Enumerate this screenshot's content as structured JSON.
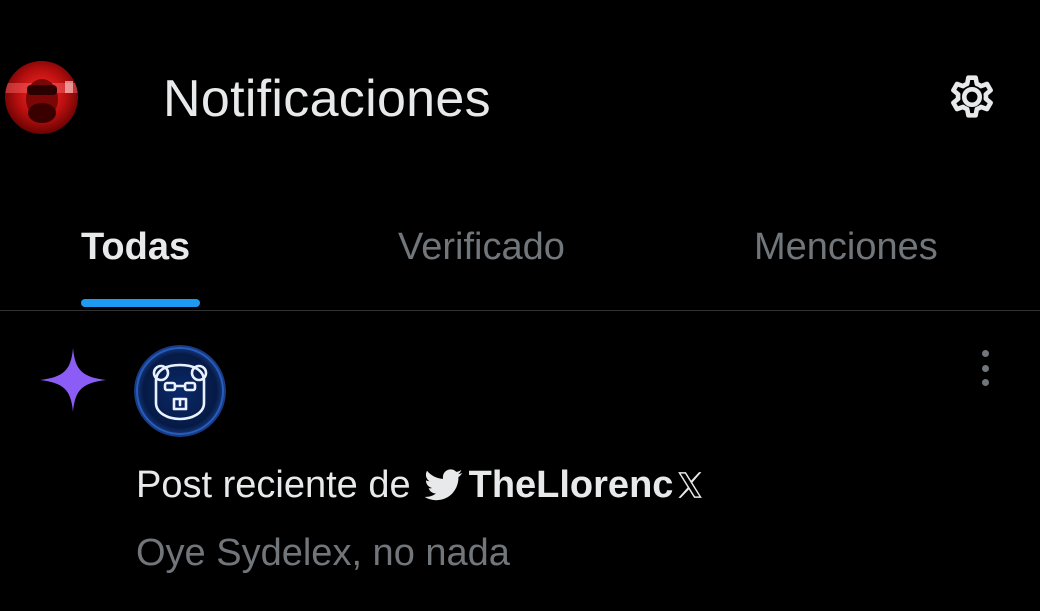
{
  "header": {
    "title": "Notificaciones",
    "avatar_icon": "user-avatar",
    "settings_icon": "gear-icon"
  },
  "tabs": [
    {
      "label": "Todas",
      "active": true
    },
    {
      "label": "Verificado",
      "active": false
    },
    {
      "label": "Menciones",
      "active": false
    }
  ],
  "notifications": [
    {
      "type_icon": "sparkle-icon",
      "avatar_icon": "bear-avatar",
      "prefix": "Post reciente de",
      "user_icon": "bird-icon",
      "user_name": "TheLlorenc",
      "user_suffix_icon": "x-logo-icon",
      "preview": "Oye Sydelex, no nada",
      "more_icon": "more-vertical-icon"
    }
  ],
  "colors": {
    "background": "#000000",
    "text_primary": "#e7e9ea",
    "text_secondary": "#71767b",
    "accent": "#1d9bf0",
    "sparkle": "#8b5cf6",
    "divider": "#2f3336"
  }
}
